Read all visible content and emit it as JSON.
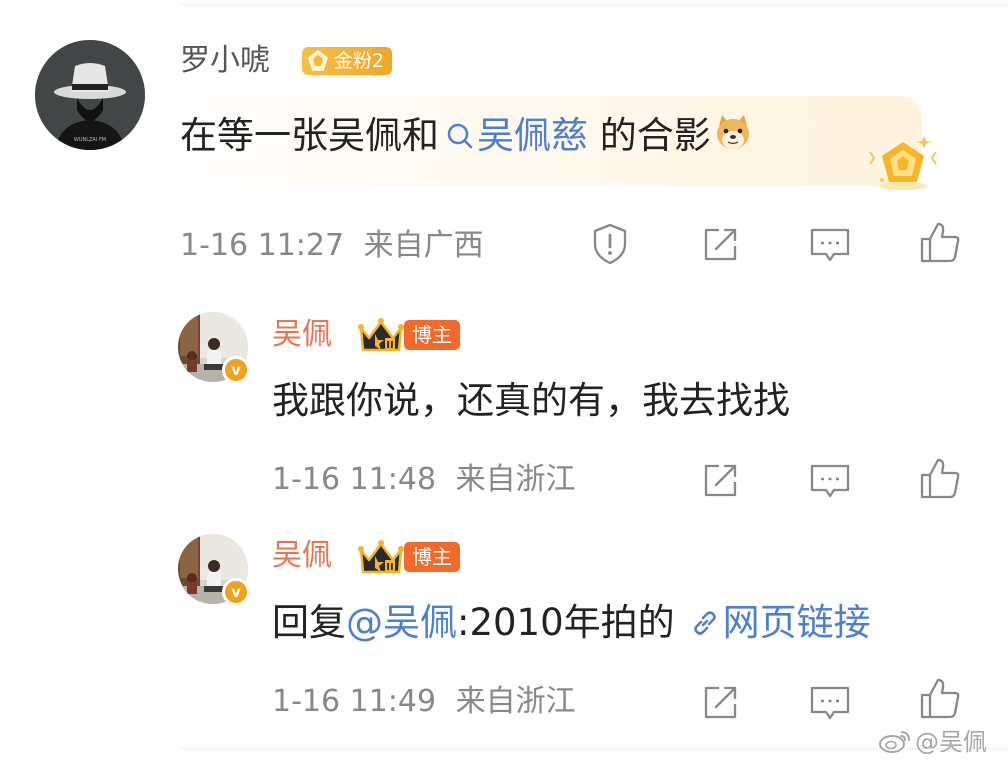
{
  "comment": {
    "user_name": "罗小唬",
    "fan_badge": "金粉2",
    "text_before": "在等一张吴佩和",
    "search_link": "吴佩慈",
    "text_after": " 的合影",
    "time": "1-16 11:27",
    "location": "来自广西"
  },
  "replies": [
    {
      "user_name": "吴佩",
      "role_badge": "博主",
      "text": "我跟你说，还真的有，我去找找",
      "time": "1-16 11:48",
      "location": "来自浙江"
    },
    {
      "user_name": "吴佩",
      "role_badge": "博主",
      "text_prefix": "回复",
      "mention": "@吴佩",
      "text_body": ":2010年拍的",
      "web_link": "网页链接",
      "time": "1-16 11:49",
      "location": "来自浙江"
    }
  ],
  "watermark": "@吴佩",
  "icons": [
    "report-icon",
    "share-icon",
    "comment-icon",
    "like-icon",
    "search-icon",
    "link-icon",
    "verified-icon",
    "crown-icon",
    "doge-emoji-icon",
    "weibo-logo-icon"
  ],
  "colors": {
    "name_orange": "#eb7350",
    "link_blue": "#4c7fcf",
    "badge_orange": "#f06a2c",
    "gold": "#f2a627",
    "meta_gray": "#888888"
  }
}
